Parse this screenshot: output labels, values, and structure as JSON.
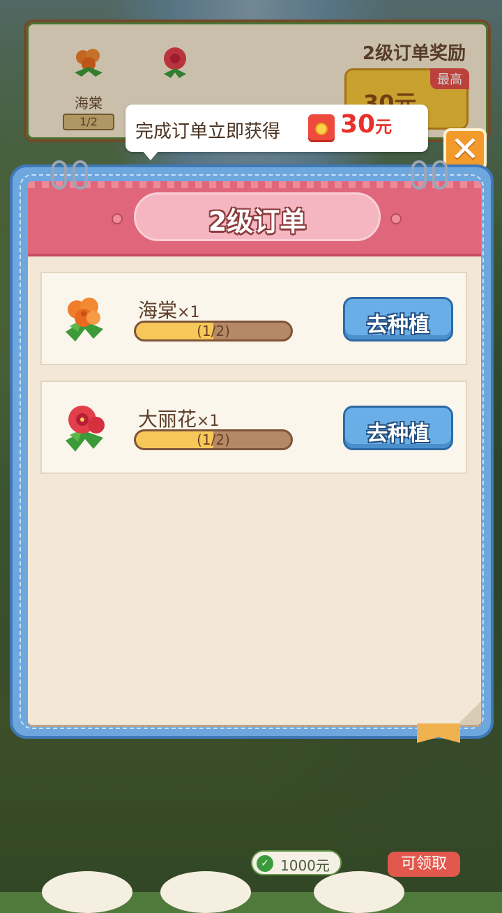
{
  "reward_banner": {
    "items": [
      {
        "name": "海棠",
        "count": "1/2"
      },
      {
        "name": "大丽花",
        "count": ""
      }
    ],
    "title": "2级订单奖励",
    "amount": "30元",
    "max_badge": "最高"
  },
  "tooltip": {
    "text": "完成订单立即获得",
    "amount": "30",
    "unit": "元"
  },
  "close_label": "✕",
  "panel": {
    "title": "2级订单",
    "orders": [
      {
        "name": "海棠",
        "qty": "×1",
        "progress_text": "(1/2)",
        "progress": 0.5,
        "button": "去种植",
        "flower_color": "#f07d2a"
      },
      {
        "name": "大丽花",
        "qty": "×1",
        "progress_text": "(1/2)",
        "progress": 0.5,
        "button": "去种植",
        "flower_color": "#e23f4a"
      }
    ]
  },
  "hud": {
    "balance": "1000元",
    "claim": "可领取"
  },
  "colors": {
    "header_pink": "#e0677b",
    "button_blue": "#6aaee8",
    "accent_red": "#e8312b"
  }
}
